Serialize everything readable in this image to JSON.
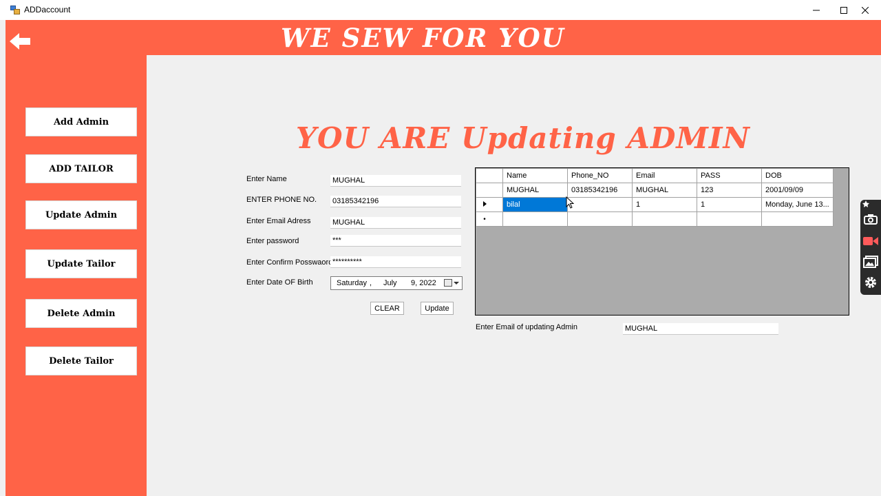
{
  "window": {
    "title": "ADDaccount"
  },
  "header": {
    "brand": "WE SEW FOR YOU"
  },
  "sidebar": {
    "items": [
      {
        "label": "Add Admin"
      },
      {
        "label": "ADD TAILOR"
      },
      {
        "label": "Update Admin"
      },
      {
        "label": "Update Tailor"
      },
      {
        "label": "Delete Admin"
      },
      {
        "label": "Delete Tailor"
      }
    ]
  },
  "main": {
    "title": "YOU ARE Updating ADMIN"
  },
  "form": {
    "name_label": "Enter Name",
    "name_value": "MUGHAL",
    "phone_label": "ENTER PHONE NO.",
    "phone_value": "03185342196",
    "email_label": "Enter Email Adress",
    "email_value": "MUGHAL",
    "password_label": "Enter password",
    "password_value": "***",
    "confirm_label": "Enter Confirm Posswaord",
    "confirm_value": "**********",
    "dob_label": "Enter Date OF Birth",
    "dob_day": "Saturday",
    "dob_sep": ",",
    "dob_month": "July",
    "dob_date": "9, 2022",
    "clear_label": "CLEAR",
    "update_label": "Update"
  },
  "grid": {
    "columns": [
      "Name",
      "Phone_NO",
      "Email",
      "PASS",
      "DOB"
    ],
    "rows": [
      [
        "MUGHAL",
        "03185342196",
        "MUGHAL",
        "123",
        "2001/09/09"
      ],
      [
        "bilal",
        "",
        "1",
        "1",
        "Monday, June 13..."
      ]
    ]
  },
  "lookup": {
    "label": "Enter Email of updating Admin",
    "value": "MUGHAL"
  },
  "colors": {
    "accent": "#ff6347",
    "selection": "#0078d7"
  }
}
